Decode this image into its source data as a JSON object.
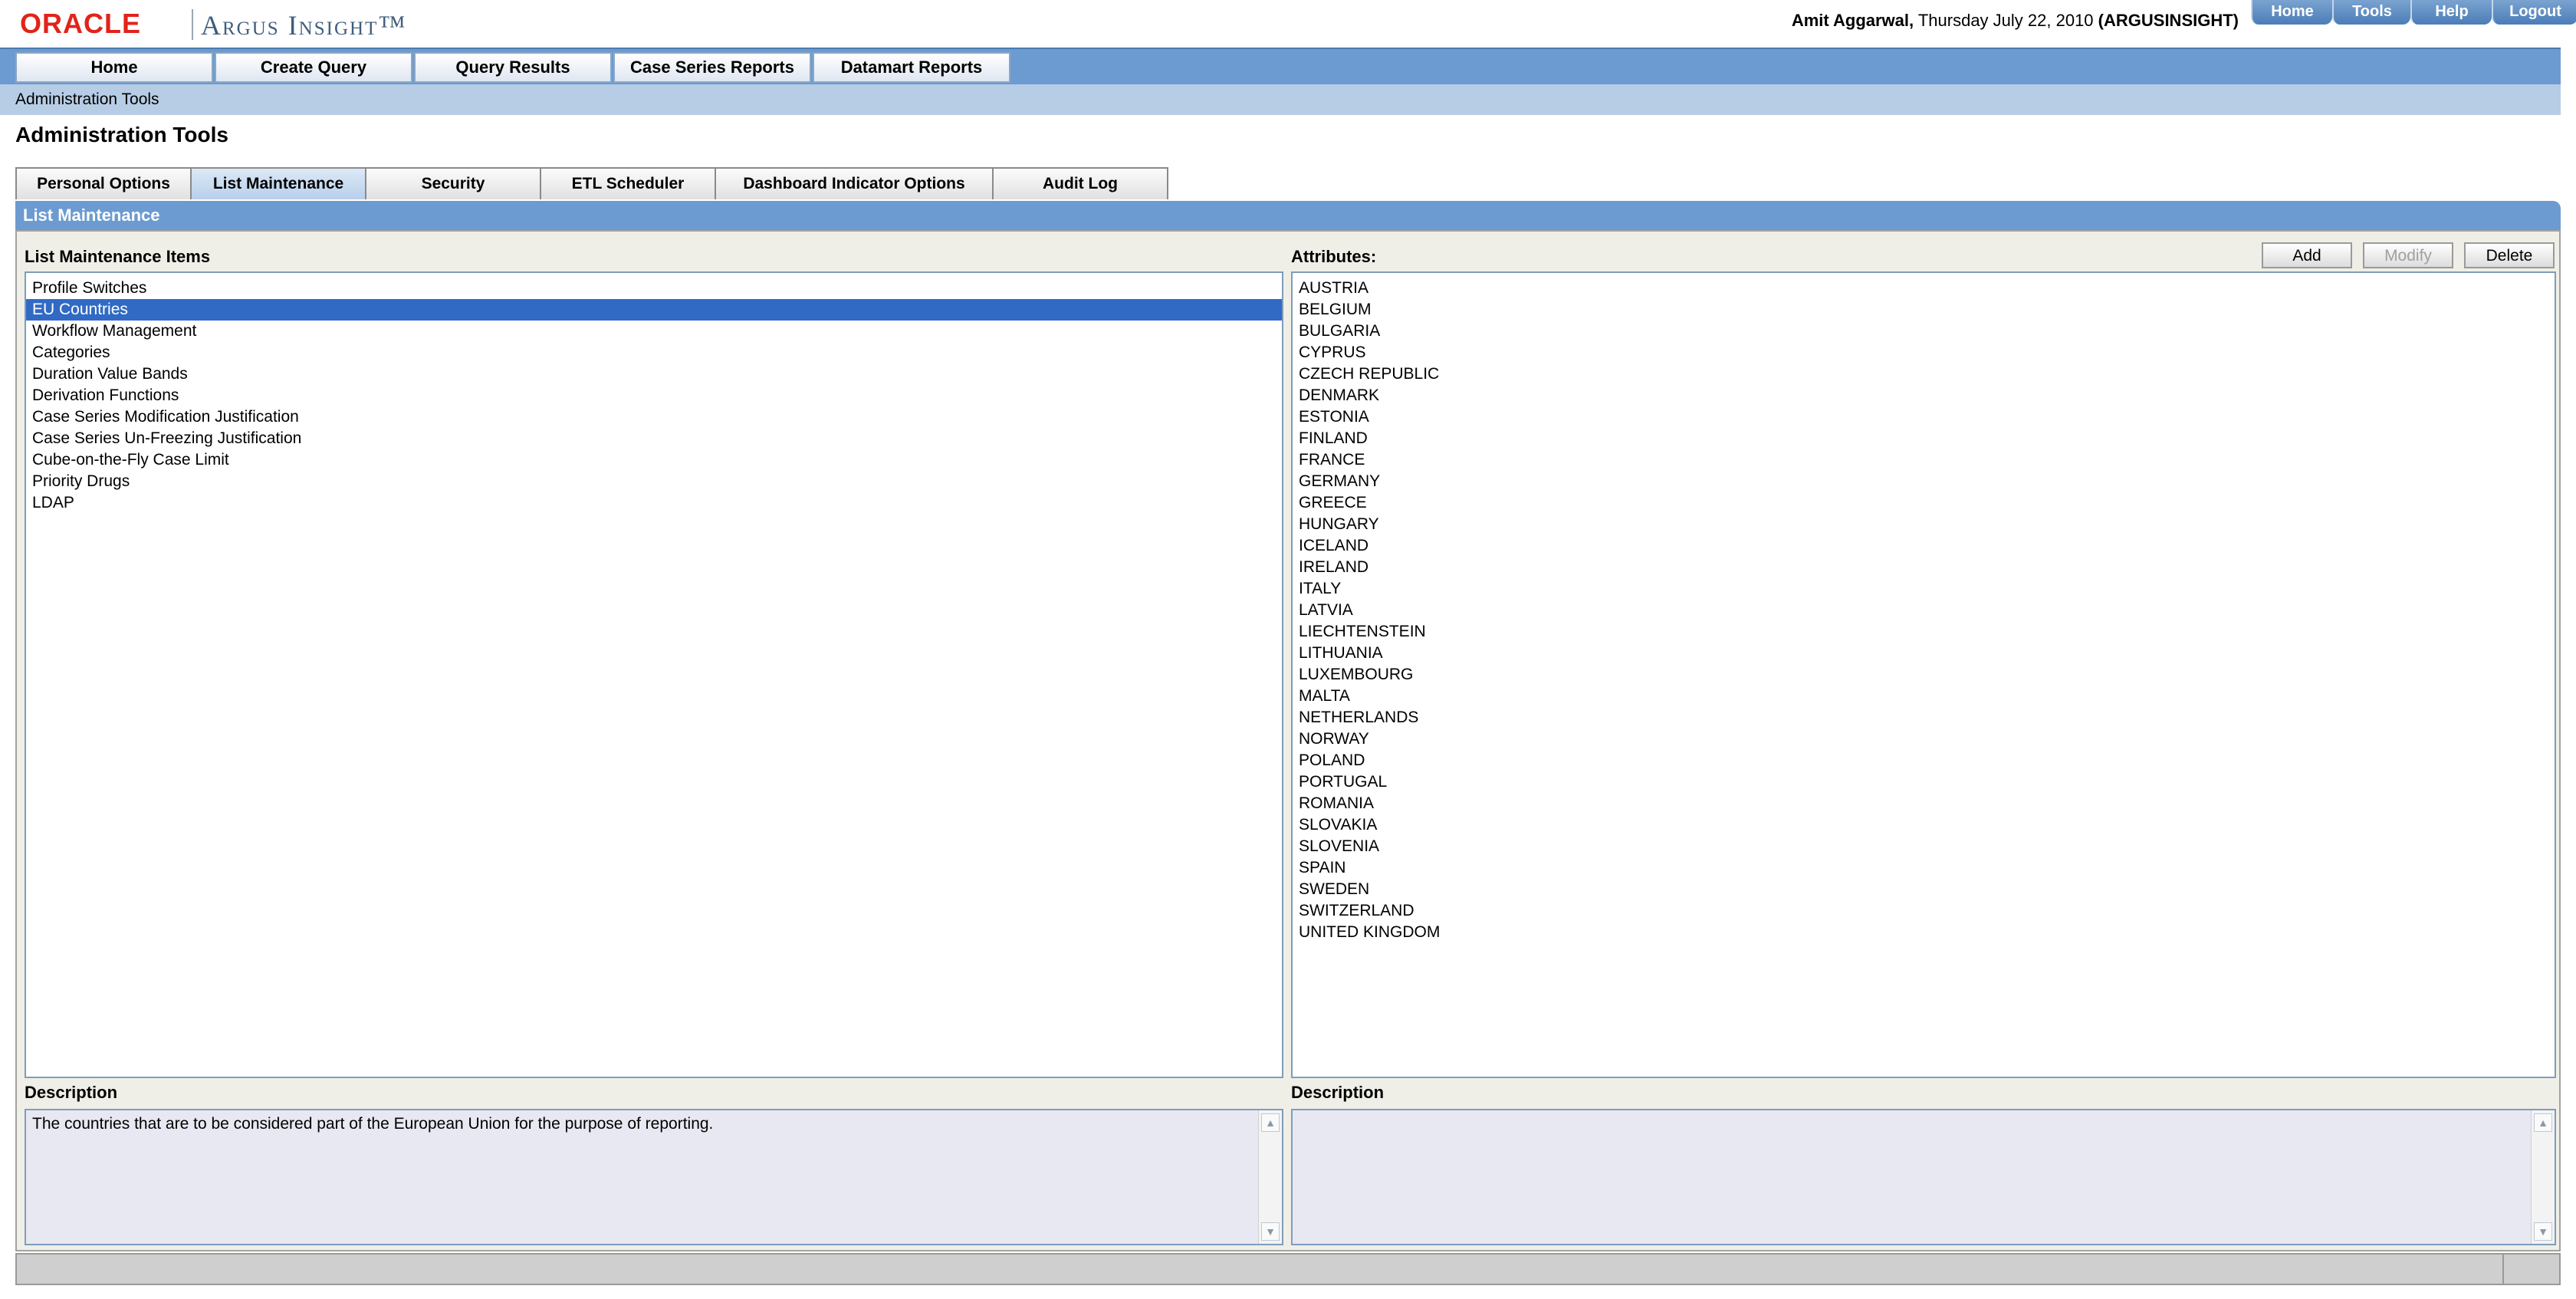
{
  "header": {
    "logo_oracle": "ORACLE",
    "logo_product": "Argus Insight™",
    "user_name": "Amit Aggarwal,",
    "date_text": " Thursday July 22, 2010 ",
    "instance": "(ARGUSINSIGHT)",
    "links": [
      "Home",
      "Tools",
      "Help",
      "Logout"
    ]
  },
  "nav": {
    "items": [
      "Home",
      "Create Query",
      "Query Results",
      "Case Series Reports",
      "Datamart Reports"
    ]
  },
  "breadcrumb": "Administration Tools",
  "page_title": "Administration Tools",
  "tabs": {
    "items": [
      "Personal Options",
      "List Maintenance",
      "Security",
      "ETL Scheduler",
      "Dashboard Indicator Options",
      "Audit Log"
    ],
    "active": "List Maintenance"
  },
  "panel": {
    "title": "List Maintenance",
    "items_label": "List Maintenance Items",
    "attributes_label": "Attributes:",
    "buttons": {
      "add": "Add",
      "modify": "Modify",
      "delete": "Delete"
    },
    "items": [
      "Profile Switches",
      "EU Countries",
      "Workflow Management",
      "Categories",
      "Duration Value Bands",
      "Derivation Functions",
      "Case Series Modification Justification",
      "Case Series Un-Freezing Justification",
      "Cube-on-the-Fly Case Limit",
      "Priority Drugs",
      "LDAP"
    ],
    "selected_item": "EU Countries",
    "attributes": [
      "AUSTRIA",
      "BELGIUM",
      "BULGARIA",
      "CYPRUS",
      "CZECH REPUBLIC",
      "DENMARK",
      "ESTONIA",
      "FINLAND",
      "FRANCE",
      "GERMANY",
      "GREECE",
      "HUNGARY",
      "ICELAND",
      "IRELAND",
      "ITALY",
      "LATVIA",
      "LIECHTENSTEIN",
      "LITHUANIA",
      "LUXEMBOURG",
      "MALTA",
      "NETHERLANDS",
      "NORWAY",
      "POLAND",
      "PORTUGAL",
      "ROMANIA",
      "SLOVAKIA",
      "SLOVENIA",
      "SPAIN",
      "SWEDEN",
      "SWITZERLAND",
      "UNITED KINGDOM"
    ],
    "left_description_label": "Description",
    "left_description": "The countries that are to be considered part of the European Union for the purpose of reporting.",
    "right_description_label": "Description",
    "right_description": ""
  },
  "colors": {
    "nav_blue": "#6b9bd0",
    "selection": "#316ac5",
    "oracle_red": "#e2231a"
  }
}
